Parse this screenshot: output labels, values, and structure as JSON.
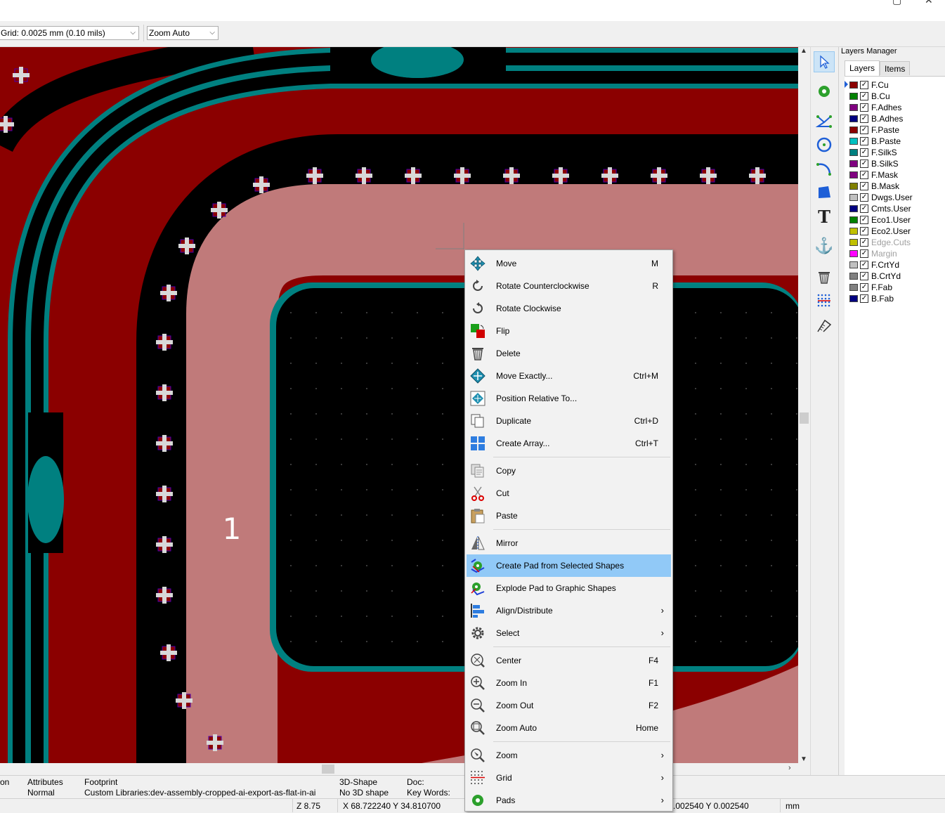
{
  "window": {
    "minimize_glyph": "▢",
    "close_glyph": "✕"
  },
  "toolbar": {
    "grid_value": "Grid: 0.0025 mm (0.10 mils)",
    "zoom_value": "Zoom Auto",
    "dropdown_glyph": "⌵"
  },
  "canvas": {
    "pad_number": "1"
  },
  "colors": {
    "board_red": "#8b0000",
    "pad_pink": "#c07a7a",
    "teal": "#008080",
    "silk_white": "#d8d8d8",
    "highlight": "#91c9f7"
  },
  "right_toolbar": {
    "tools": [
      "select-arrow-icon",
      "pad-icon",
      "line-icon",
      "circle-icon",
      "arc-icon",
      "polygon-icon",
      "text-icon",
      "anchor-icon",
      "delete-icon",
      "grid-origin-icon",
      "measure-icon"
    ],
    "text_tool_glyph": "T",
    "anchor_glyph": "⚓"
  },
  "layers_manager": {
    "title": "Layers Manager",
    "tabs": [
      "Layers",
      "Items"
    ],
    "layers": [
      {
        "name": "F.Cu",
        "color": "#8b0000",
        "checked": true,
        "active": true
      },
      {
        "name": "B.Cu",
        "color": "#008000",
        "checked": true
      },
      {
        "name": "F.Adhes",
        "color": "#800080",
        "checked": true
      },
      {
        "name": "B.Adhes",
        "color": "#000080",
        "checked": true
      },
      {
        "name": "F.Paste",
        "color": "#8b0000",
        "checked": true
      },
      {
        "name": "B.Paste",
        "color": "#00c0c0",
        "checked": true
      },
      {
        "name": "F.SilkS",
        "color": "#008080",
        "checked": true
      },
      {
        "name": "B.SilkS",
        "color": "#800080",
        "checked": true
      },
      {
        "name": "F.Mask",
        "color": "#800080",
        "checked": true
      },
      {
        "name": "B.Mask",
        "color": "#808000",
        "checked": true
      },
      {
        "name": "Dwgs.User",
        "color": "#c0c0c0",
        "checked": true
      },
      {
        "name": "Cmts.User",
        "color": "#000080",
        "checked": true
      },
      {
        "name": "Eco1.User",
        "color": "#008000",
        "checked": true
      },
      {
        "name": "Eco2.User",
        "color": "#c0c000",
        "checked": true
      },
      {
        "name": "Edge.Cuts",
        "color": "#c0c000",
        "checked": true,
        "dim": true
      },
      {
        "name": "Margin",
        "color": "#ff00ff",
        "checked": true,
        "dim": true
      },
      {
        "name": "F.CrtYd",
        "color": "#c0c0c0",
        "checked": true
      },
      {
        "name": "B.CrtYd",
        "color": "#808080",
        "checked": true
      },
      {
        "name": "F.Fab",
        "color": "#808080",
        "checked": true
      },
      {
        "name": "B.Fab",
        "color": "#000080",
        "checked": true
      }
    ],
    "check_glyph": "✓"
  },
  "status": {
    "col0_label": "on",
    "attributes_label": "Attributes",
    "attributes_value": "Normal",
    "footprint_label": "Footprint",
    "footprint_value": "Custom Libraries:dev-assembly-cropped-ai-export-as-flat-in-ai",
    "shape3d_label": "3D-Shape",
    "shape3d_value": "No 3D shape",
    "doc_label": "Doc:",
    "keywords_label": "Key Words:",
    "zoom": "Z 8.75",
    "xy": "X 68.722240  Y 34.810700",
    "dxy": ".002540  Y 0.002540",
    "units": "mm"
  },
  "context_menu": {
    "items": [
      {
        "label": "Move",
        "shortcut": "M",
        "icon": "move-icon"
      },
      {
        "label": "Rotate Counterclockwise",
        "shortcut": "R",
        "icon": "rotate-ccw-icon"
      },
      {
        "label": "Rotate Clockwise",
        "shortcut": "",
        "icon": "rotate-cw-icon"
      },
      {
        "label": "Flip",
        "shortcut": "",
        "icon": "flip-icon"
      },
      {
        "label": "Delete",
        "shortcut": "",
        "icon": "delete-icon"
      },
      {
        "label": "Move Exactly...",
        "shortcut": "Ctrl+M",
        "icon": "move-exactly-icon"
      },
      {
        "label": "Position Relative To...",
        "shortcut": "",
        "icon": "position-relative-icon"
      },
      {
        "label": "Duplicate",
        "shortcut": "Ctrl+D",
        "icon": "duplicate-icon"
      },
      {
        "label": "Create Array...",
        "shortcut": "Ctrl+T",
        "icon": "array-icon"
      },
      {
        "label": "Copy",
        "shortcut": "",
        "icon": "copy-icon"
      },
      {
        "label": "Cut",
        "shortcut": "",
        "icon": "scissors-icon"
      },
      {
        "label": "Paste",
        "shortcut": "",
        "icon": "paste-icon"
      },
      {
        "label": "Mirror",
        "shortcut": "",
        "icon": "mirror-icon"
      },
      {
        "label": "Create Pad from Selected Shapes",
        "shortcut": "",
        "icon": "create-pad-icon",
        "highlighted": true
      },
      {
        "label": "Explode Pad to Graphic Shapes",
        "shortcut": "",
        "icon": "explode-pad-icon"
      },
      {
        "label": "Align/Distribute",
        "shortcut": "",
        "icon": "align-icon",
        "submenu": true
      },
      {
        "label": "Select",
        "shortcut": "",
        "icon": "gear-icon",
        "submenu": true
      },
      {
        "label": "Center",
        "shortcut": "F4",
        "icon": "zoom-center-icon"
      },
      {
        "label": "Zoom In",
        "shortcut": "F1",
        "icon": "zoom-in-icon"
      },
      {
        "label": "Zoom Out",
        "shortcut": "F2",
        "icon": "zoom-out-icon"
      },
      {
        "label": "Zoom Auto",
        "shortcut": "Home",
        "icon": "zoom-auto-icon"
      },
      {
        "label": "Zoom",
        "shortcut": "",
        "icon": "zoom-icon",
        "submenu": true
      },
      {
        "label": "Grid",
        "shortcut": "",
        "icon": "grid-icon",
        "submenu": true
      },
      {
        "label": "Pads",
        "shortcut": "",
        "icon": "pad-icon",
        "submenu": true
      }
    ],
    "submenu_glyph": "›"
  }
}
